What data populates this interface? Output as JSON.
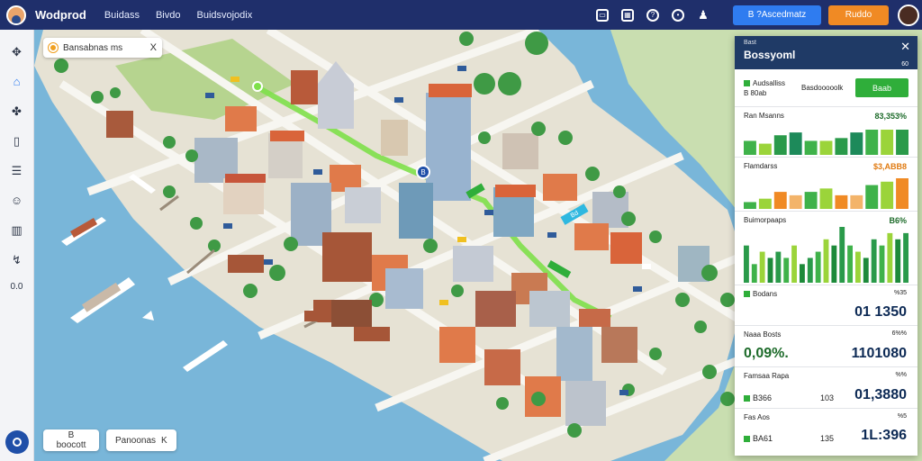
{
  "topbar": {
    "brand": "Wodprod",
    "nav": [
      "Buidass",
      "Bivdo",
      "Buidsvojodix"
    ],
    "primary_button": "B ?Ascedmatz",
    "secondary_button": "Ruddo",
    "icons": [
      "inbox-icon",
      "calendar-icon",
      "help-icon",
      "chat-icon",
      "user-icon"
    ]
  },
  "sidebar": {
    "items": [
      "move-icon",
      "home-icon",
      "puzzle-icon",
      "bookmark-icon",
      "list-icon",
      "user-icon",
      "building-icon",
      "route-icon"
    ],
    "zoom_text": "0.0"
  },
  "map": {
    "search_chip": "Bansabnas ms",
    "search_close": "X",
    "bottom_btn_1": "B boocott",
    "bottom_btn_2": "Panoonas",
    "bottom_btn_2_icon": "K",
    "vehicle_badge": "Bd",
    "marker": "B"
  },
  "panel": {
    "header_sub": "Bast",
    "title": "Bossyoml",
    "header_small": "60",
    "summary": {
      "col1_line1": "Audsalliss",
      "col1_line2": "B 80ab",
      "col2_line1": "",
      "col2_line2": "Basdooooolk",
      "button": "Baab"
    },
    "charts": [
      {
        "label": "Ran Msanns",
        "value": "83,353%",
        "value_color": "#1d6b2a"
      },
      {
        "label": "Flamdarss",
        "value": "$3,ABB8",
        "value_color": "#e07a10"
      },
      {
        "label": "Buimorpaaps",
        "value": "B6%",
        "value_color": "#1d6b2a"
      }
    ],
    "stats": [
      {
        "label": "Bodans",
        "small_r": "%35",
        "big_l": "",
        "big_r": "01 1350",
        "mid": ""
      },
      {
        "label": "Naaa Bosts",
        "small_r": "6%%",
        "big_l": "0,09%.",
        "big_r": "1101080",
        "mid": ""
      },
      {
        "label": "Famsaa Rapa",
        "small_r": "%%",
        "big_l": "",
        "big_r": "01,3880",
        "mid": "103"
      },
      {
        "label": "Fas Aos",
        "small_r": "%5",
        "big_l": "",
        "big_r": "1L:396",
        "mid": "135"
      }
    ],
    "stat_left_values": [
      "",
      "",
      "B366",
      "BA61"
    ]
  },
  "chart_data": [
    {
      "type": "bar",
      "label": "Ran Msanns",
      "values": [
        5,
        4,
        7,
        8,
        5,
        5,
        6,
        8,
        9,
        9,
        9
      ]
    },
    {
      "type": "bar",
      "label": "Flamdarss",
      "values": [
        2,
        3,
        5,
        4,
        5,
        6,
        4,
        4,
        7,
        8,
        9
      ]
    },
    {
      "type": "bar",
      "label": "Buimorpaaps",
      "values": [
        6,
        3,
        5,
        4,
        5,
        4,
        6,
        3,
        4,
        5,
        7,
        6,
        9,
        6,
        5,
        4,
        7,
        6,
        8,
        7,
        8
      ]
    }
  ]
}
